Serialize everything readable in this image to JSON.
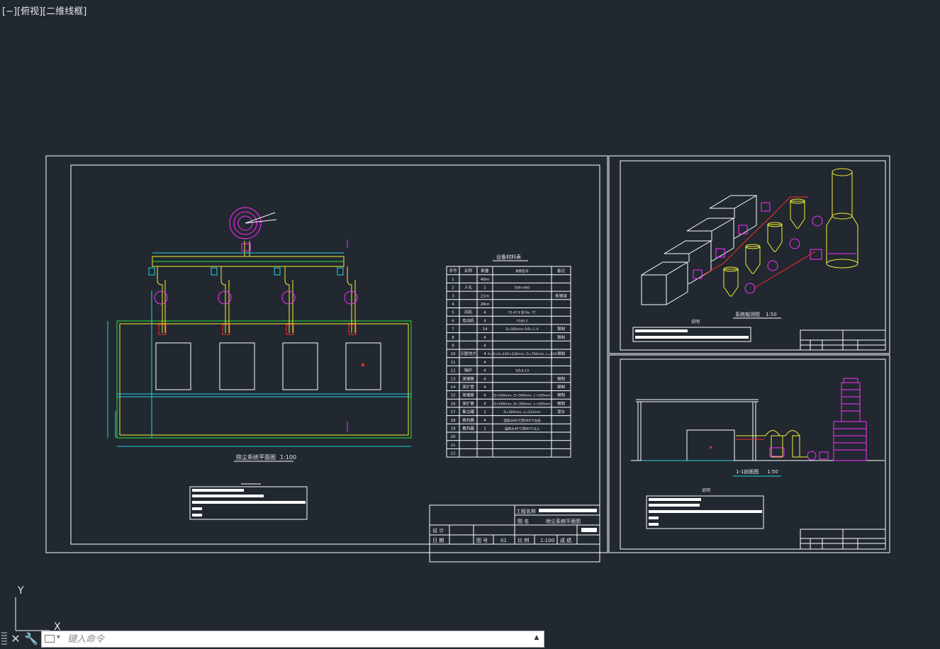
{
  "viewport": {
    "label": "[−][俯视][二维线框]"
  },
  "ucs": {
    "y_label": "Y",
    "x_label": "X"
  },
  "sheet1": {
    "plan_title": "除尘系统平面图",
    "plan_scale": "1:100",
    "table_title": "设备材料表",
    "table_headers": [
      "序号",
      "名称",
      "数量",
      "规格型号",
      "备注"
    ],
    "table_rows": [
      [
        "1",
        "",
        "40m",
        "",
        ""
      ],
      [
        "2",
        "人孔",
        "1",
        "500×400",
        ""
      ],
      [
        "3",
        "",
        "21m",
        "",
        "炼钢道"
      ],
      [
        "4",
        "",
        "26m",
        "",
        ""
      ],
      [
        "5",
        "风机",
        "4",
        "Y5-47 Ⅱ 型 No. 7C",
        ""
      ],
      [
        "6",
        "电动机",
        "4",
        "Y180-2",
        ""
      ],
      [
        "7",
        "",
        "14",
        "D=560mm R/D=1.0",
        "钢制"
      ],
      [
        "8",
        "",
        "4",
        "",
        "钢制"
      ],
      [
        "9",
        "",
        "4",
        "",
        ""
      ],
      [
        "10",
        "天圆地方",
        "4",
        "A×B×H=440×330mm, D=760mm, L=500",
        "钢制"
      ],
      [
        "11",
        "",
        "4",
        "",
        ""
      ],
      [
        "12",
        "锅炉",
        "4",
        "SZL4-13",
        ""
      ],
      [
        "13",
        "渐缩管",
        "4",
        "",
        "钢制"
      ],
      [
        "14",
        "渐扩管",
        "4",
        "",
        "钢制"
      ],
      [
        "15",
        "渐缩管",
        "4",
        "D=560mm, D=560mm, L=200mm",
        "钢制"
      ],
      [
        "16",
        "渐扩管",
        "4",
        "D=560mm, D=300mm, L=200mm",
        "钢制"
      ],
      [
        "17",
        "集尘罐",
        "1",
        "D=560mm, L=232mm",
        "混合"
      ],
      [
        "18",
        "换热器",
        "4",
        "温度从80℃到300℃左右",
        ""
      ],
      [
        "19",
        "蓄热器",
        "1",
        "温度从40℃到80℃以上",
        ""
      ],
      [
        "20",
        "",
        "",
        "",
        ""
      ],
      [
        "21",
        "",
        "",
        "",
        ""
      ],
      [
        "22",
        "",
        "",
        "",
        ""
      ]
    ],
    "title_block": {
      "project_label": "工程名称",
      "figure_name_label": "图 名",
      "figure_name": "除尘系统平面图",
      "design_label": "设 计",
      "date_label": "日 期",
      "figure_no_label": "图 号",
      "figure_no": "01",
      "scale_label": "比 例",
      "scale": "1:100",
      "grade_label": "成 绩"
    }
  },
  "sheet2": {
    "axo_title": "系统轴测图",
    "axo_scale": "1:50",
    "notes_label": "说明"
  },
  "sheet3": {
    "section_title": "1-1剖面图",
    "section_scale": "1:50",
    "notes_label": "说明"
  },
  "command_line": {
    "placeholder": "键入命令"
  },
  "colors": {
    "background": "#212830",
    "frame": "#ffffff",
    "duct": "#f5f034",
    "dimension": "#25d3e8",
    "equipment": "#ff2cff",
    "green": "#29e03a",
    "red": "#ff2a2a"
  }
}
